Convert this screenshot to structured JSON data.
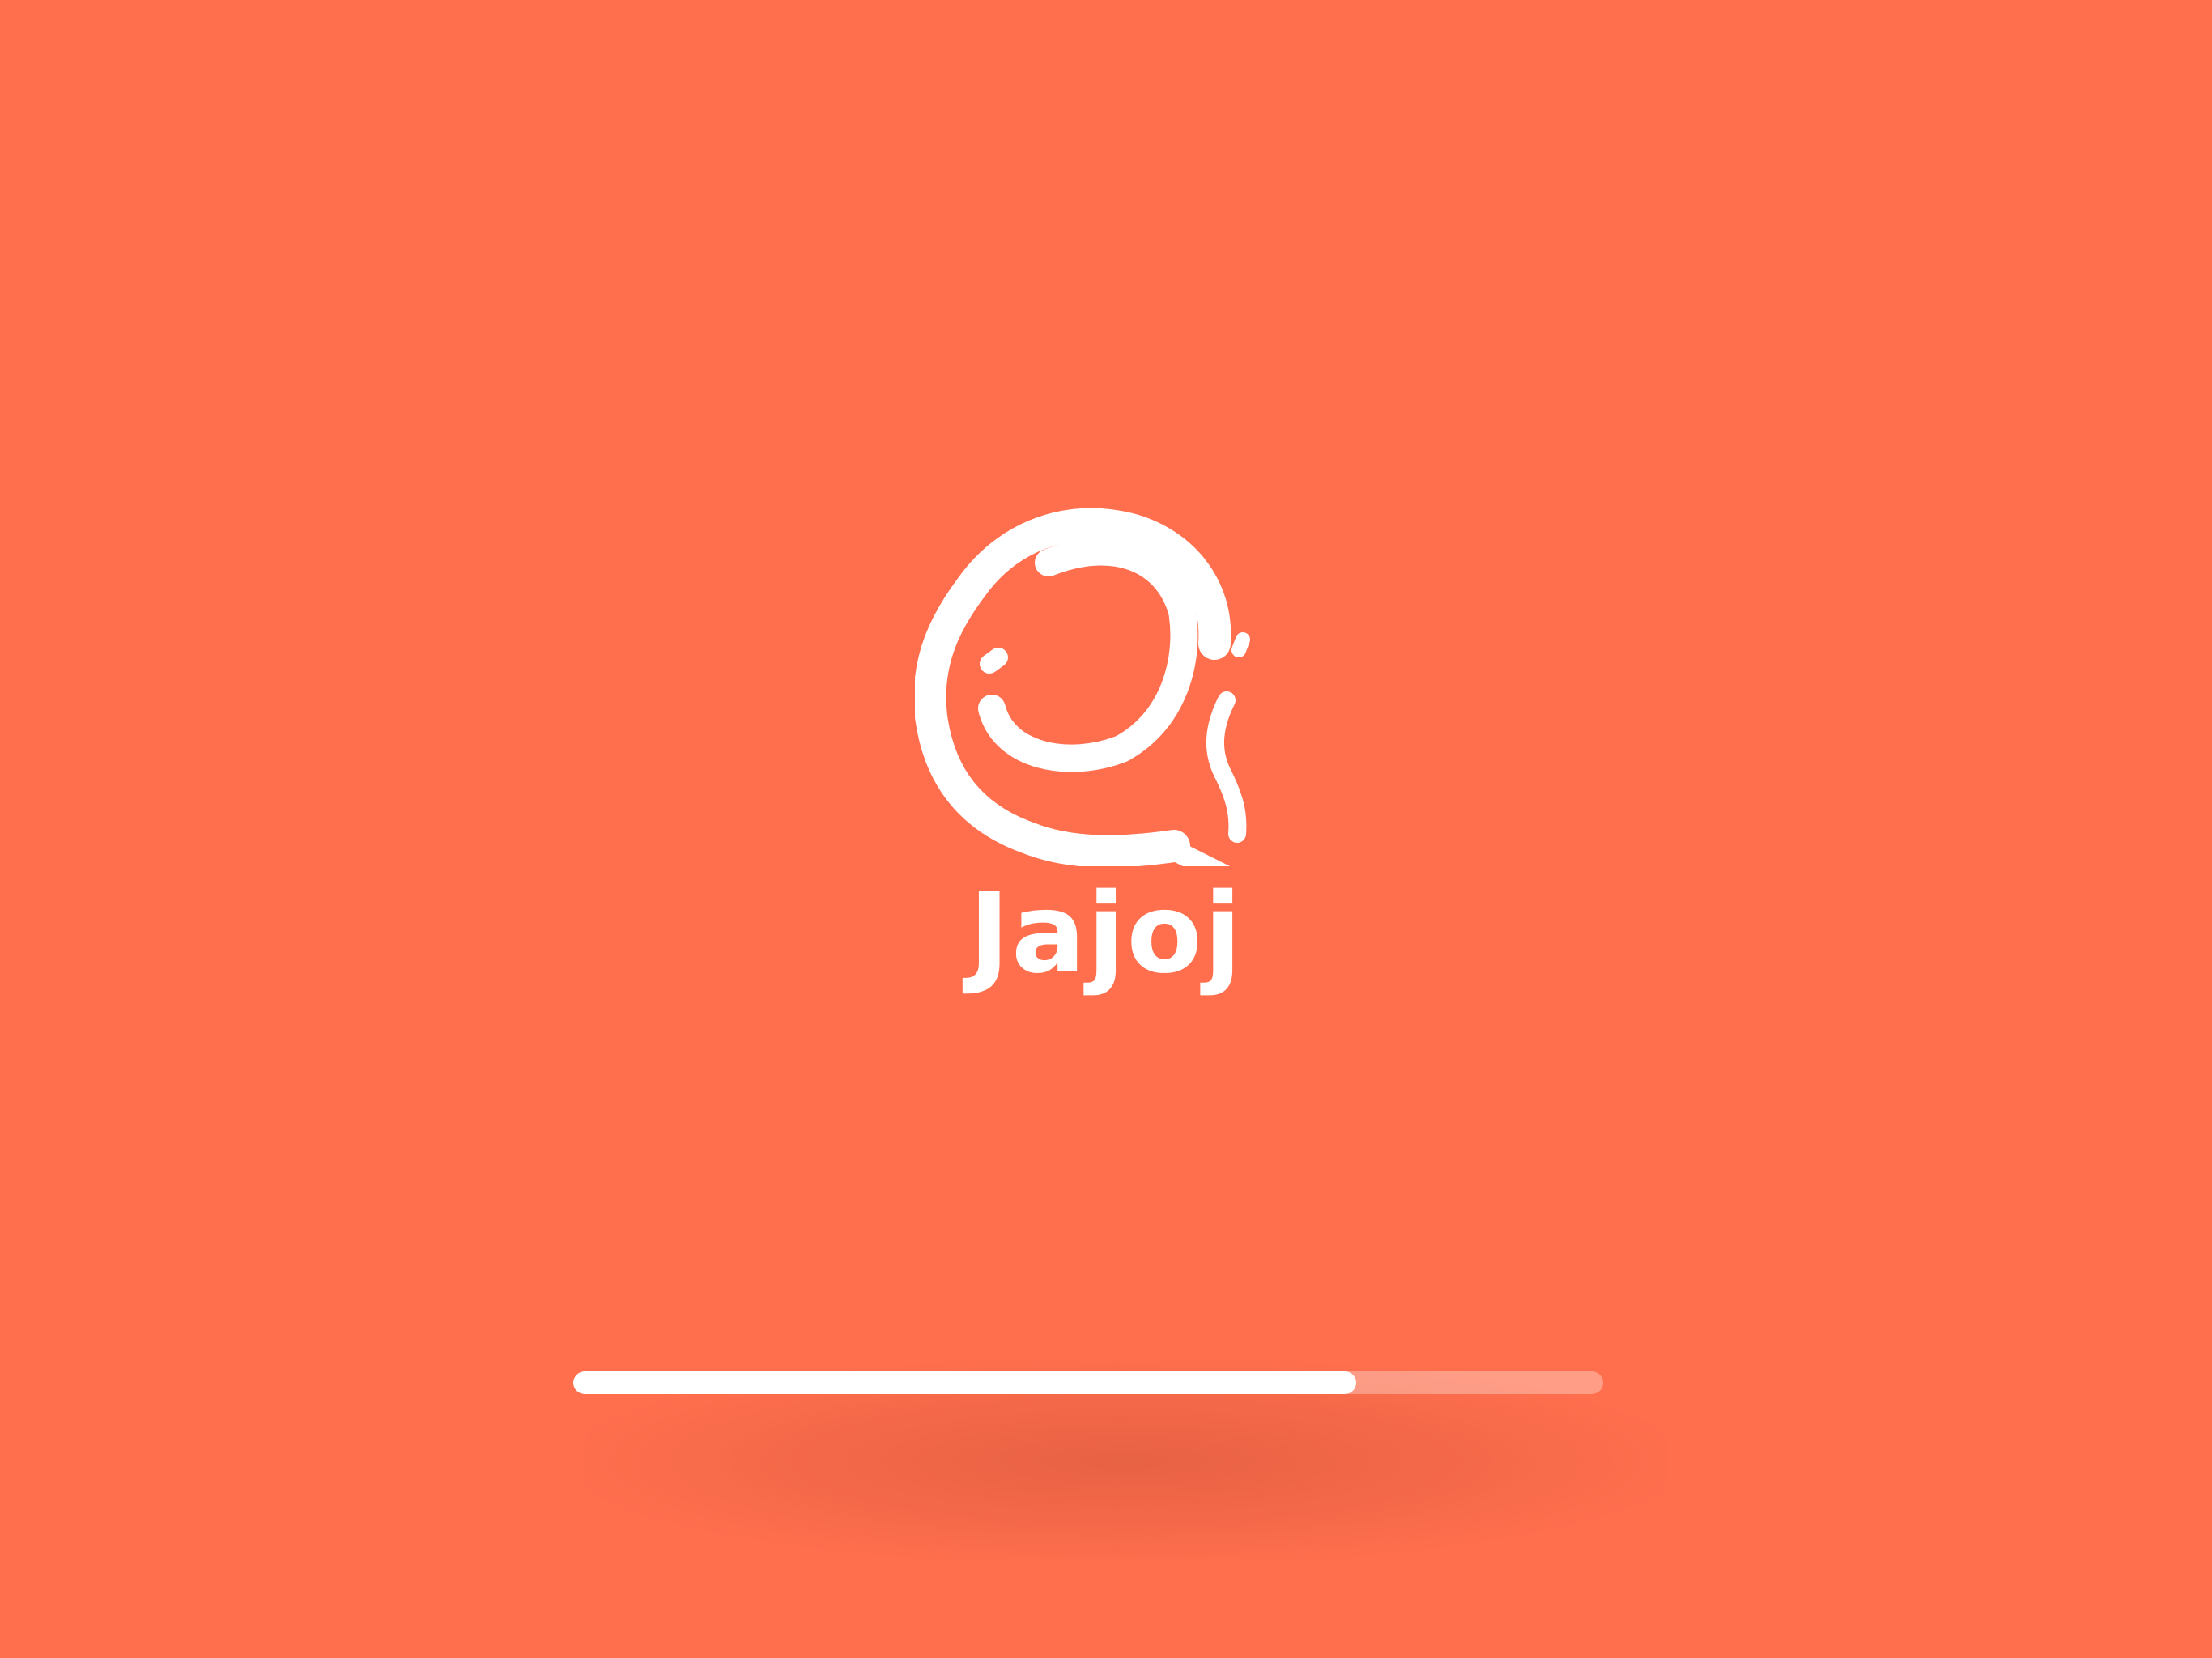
{
  "app": {
    "name": "Jajoj"
  },
  "loader": {
    "progress": 0.76
  },
  "colors": {
    "background": "#FF6F4E",
    "foreground": "#FFFFFF"
  },
  "icons": {
    "logo": "smiling-face-speech-bubble-logo"
  }
}
